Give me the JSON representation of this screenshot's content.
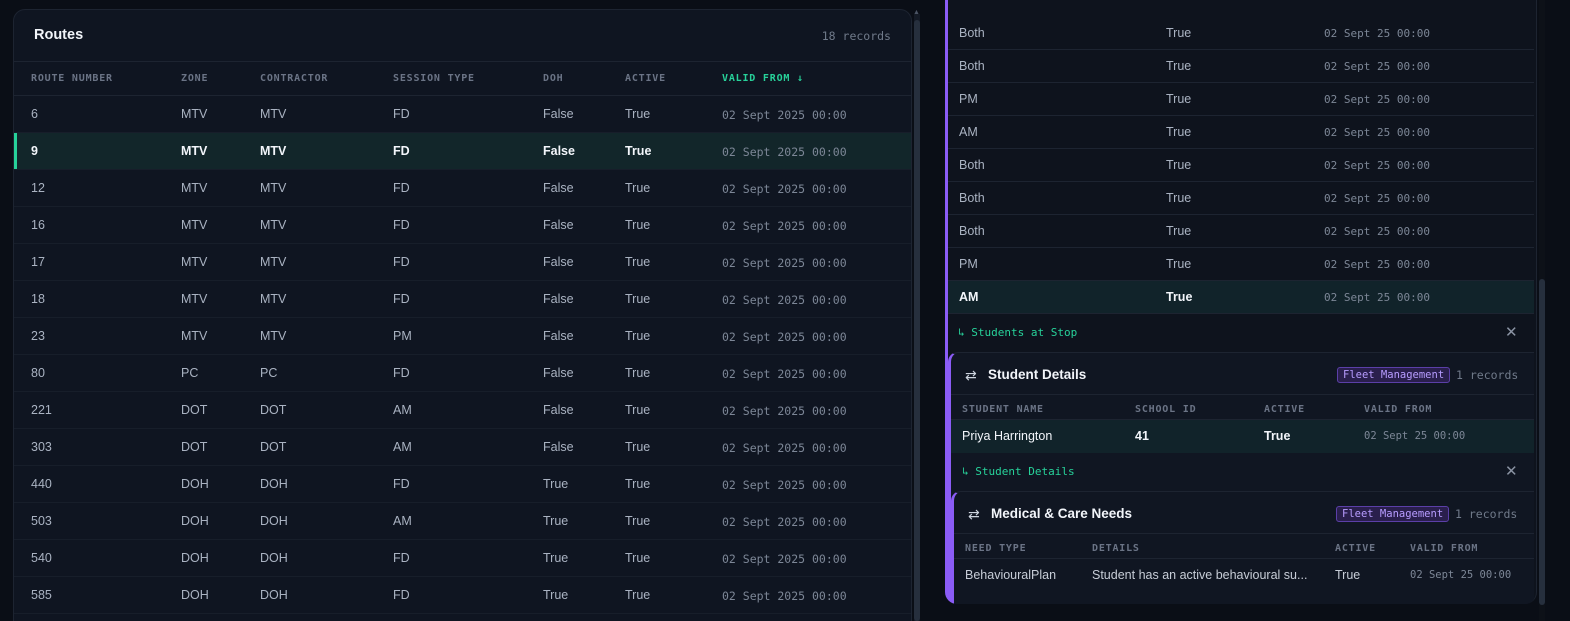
{
  "routes": {
    "title": "Routes",
    "count": "18 records",
    "columns": [
      "ROUTE NUMBER",
      "ZONE",
      "CONTRACTOR",
      "SESSION TYPE",
      "DOH",
      "ACTIVE",
      "VALID FROM ↓"
    ],
    "rows": [
      [
        "6",
        "MTV",
        "MTV",
        "FD",
        "False",
        "True",
        "02 Sept 2025 00:00"
      ],
      [
        "9",
        "MTV",
        "MTV",
        "FD",
        "False",
        "True",
        "02 Sept 2025 00:00"
      ],
      [
        "12",
        "MTV",
        "MTV",
        "FD",
        "False",
        "True",
        "02 Sept 2025 00:00"
      ],
      [
        "16",
        "MTV",
        "MTV",
        "FD",
        "False",
        "True",
        "02 Sept 2025 00:00"
      ],
      [
        "17",
        "MTV",
        "MTV",
        "FD",
        "False",
        "True",
        "02 Sept 2025 00:00"
      ],
      [
        "18",
        "MTV",
        "MTV",
        "FD",
        "False",
        "True",
        "02 Sept 2025 00:00"
      ],
      [
        "23",
        "MTV",
        "MTV",
        "PM",
        "False",
        "True",
        "02 Sept 2025 00:00"
      ],
      [
        "80",
        "PC",
        "PC",
        "FD",
        "False",
        "True",
        "02 Sept 2025 00:00"
      ],
      [
        "221",
        "DOT",
        "DOT",
        "AM",
        "False",
        "True",
        "02 Sept 2025 00:00"
      ],
      [
        "303",
        "DOT",
        "DOT",
        "AM",
        "False",
        "True",
        "02 Sept 2025 00:00"
      ],
      [
        "440",
        "DOH",
        "DOH",
        "FD",
        "True",
        "True",
        "02 Sept 2025 00:00"
      ],
      [
        "503",
        "DOH",
        "DOH",
        "AM",
        "True",
        "True",
        "02 Sept 2025 00:00"
      ],
      [
        "540",
        "DOH",
        "DOH",
        "FD",
        "True",
        "True",
        "02 Sept 2025 00:00"
      ],
      [
        "585",
        "DOH",
        "DOH",
        "FD",
        "True",
        "True",
        "02 Sept 2025 00:00"
      ]
    ],
    "selected_route": "9"
  },
  "stops": {
    "rows": [
      [
        "Both",
        "True",
        "02 Sept 25 00:00"
      ],
      [
        "Both",
        "True",
        "02 Sept 25 00:00"
      ],
      [
        "PM",
        "True",
        "02 Sept 25 00:00"
      ],
      [
        "AM",
        "True",
        "02 Sept 25 00:00"
      ],
      [
        "Both",
        "True",
        "02 Sept 25 00:00"
      ],
      [
        "Both",
        "True",
        "02 Sept 25 00:00"
      ],
      [
        "Both",
        "True",
        "02 Sept 25 00:00"
      ],
      [
        "PM",
        "True",
        "02 Sept 25 00:00"
      ],
      [
        "AM",
        "True",
        "02 Sept 25 00:00"
      ]
    ],
    "selected_row": "last"
  },
  "breadcrumb_stop": "↳ Students at Stop",
  "student_details": {
    "title": "Student Details",
    "badge": "Fleet Management",
    "count": "1 records",
    "columns": [
      "STUDENT NAME",
      "SCHOOL ID",
      "ACTIVE",
      "VALID FROM"
    ],
    "rows": [
      [
        "Priya Harrington",
        "41",
        "True",
        "02 Sept 25 00:00"
      ]
    ]
  },
  "breadcrumb_student": "↳ Student Details",
  "medical": {
    "title": "Medical & Care Needs",
    "badge": "Fleet Management",
    "count": "1 records",
    "columns": [
      "NEED TYPE",
      "DETAILS",
      "ACTIVE",
      "VALID FROM"
    ],
    "rows": [
      [
        "BehaviouralPlan",
        "Student has an active behavioural su...",
        "True",
        "02 Sept 25 00:00"
      ]
    ]
  },
  "icons": {
    "swap": "swap-arrows-icon",
    "close": "close-icon",
    "sort": "arrow-down-icon"
  },
  "colors": {
    "accent_green": "#27d29a",
    "accent_purple": "#8b5cf6",
    "background": "#0a0e16",
    "panel": "#0f1521"
  }
}
